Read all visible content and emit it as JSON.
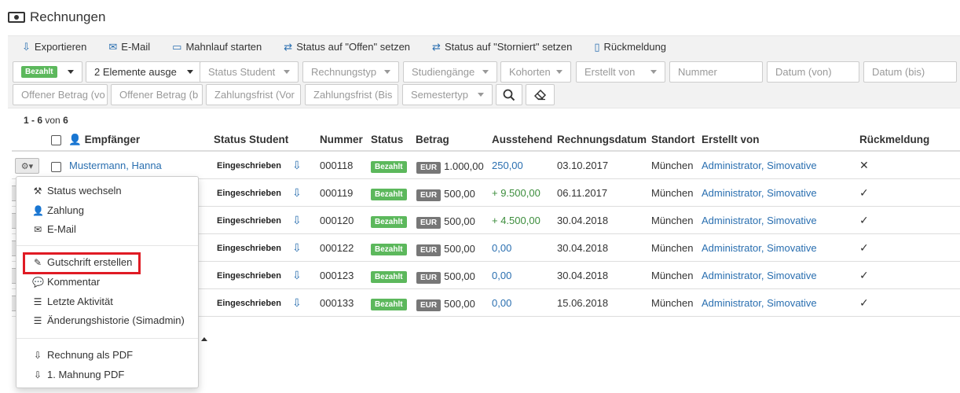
{
  "page": {
    "title": "Rechnungen",
    "title_icon": "money-bill-icon"
  },
  "toolbar": {
    "export": "Exportieren",
    "email": "E-Mail",
    "dunning": "Mahnlauf starten",
    "status_open": "Status auf \"Offen\" setzen",
    "status_cancelled": "Status auf \"Storniert\" setzen",
    "feedback": "Rückmeldung"
  },
  "filters": {
    "status_badge": "Bezahlt",
    "selected": "2 Elemente ausge",
    "status_student": "Status Student",
    "invoice_type": "Rechnungstyp",
    "programs": "Studiengänge",
    "cohorts": "Kohorten",
    "created_by": "Erstellt von",
    "number": "Nummer",
    "date_from": "Datum (von)",
    "date_to": "Datum (bis)",
    "open_amount_from": "Offener Betrag (vo",
    "open_amount_to": "Offener Betrag (b",
    "due_from": "Zahlungsfrist (Vor",
    "due_to": "Zahlungsfrist (Bis",
    "semester_type": "Semestertyp"
  },
  "count": {
    "range": "1 - 6",
    "of": "von",
    "total": "6"
  },
  "columns": {
    "recipient": "Empfänger",
    "status_student": "Status Student",
    "number": "Nummer",
    "status": "Status",
    "amount": "Betrag",
    "outstanding": "Ausstehend",
    "invoice_date": "Rechnungsdatum",
    "location": "Standort",
    "created_by": "Erstellt von",
    "feedback": "Rückmeldung"
  },
  "rows": [
    {
      "recipient": "Mustermann, Hanna",
      "status_student": "Eingeschrieben",
      "number": "000118",
      "status": "Bezahlt",
      "currency": "EUR",
      "amount": "1.000,00",
      "outstanding": "250,00",
      "date": "03.10.2017",
      "location": "München",
      "created_by": "Administrator, Simovative",
      "feedback": "✕"
    },
    {
      "recipient": "",
      "status_student": "Eingeschrieben",
      "number": "000119",
      "status": "Bezahlt",
      "currency": "EUR",
      "amount": "500,00",
      "outstanding": "+ 9.500,00",
      "date": "06.11.2017",
      "location": "München",
      "created_by": "Administrator, Simovative",
      "feedback": "✓"
    },
    {
      "recipient": "",
      "status_student": "Eingeschrieben",
      "number": "000120",
      "status": "Bezahlt",
      "currency": "EUR",
      "amount": "500,00",
      "outstanding": "+ 4.500,00",
      "date": "30.04.2018",
      "location": "München",
      "created_by": "Administrator, Simovative",
      "feedback": "✓"
    },
    {
      "recipient": "",
      "status_student": "Eingeschrieben",
      "number": "000122",
      "status": "Bezahlt",
      "currency": "EUR",
      "amount": "500,00",
      "outstanding": "0,00",
      "date": "30.04.2018",
      "location": "München",
      "created_by": "Administrator, Simovative",
      "feedback": "✓"
    },
    {
      "recipient": "",
      "status_student": "Eingeschrieben",
      "number": "000123",
      "status": "Bezahlt",
      "currency": "EUR",
      "amount": "500,00",
      "outstanding": "0,00",
      "date": "30.04.2018",
      "location": "München",
      "created_by": "Administrator, Simovative",
      "feedback": "✓"
    },
    {
      "recipient": "",
      "status_student": "Eingeschrieben",
      "number": "000133",
      "status": "Bezahlt",
      "currency": "EUR",
      "amount": "500,00",
      "outstanding": "0,00",
      "date": "15.06.2018",
      "location": "München",
      "created_by": "Administrator, Simovative",
      "feedback": "✓"
    }
  ],
  "menu": {
    "change_status": "Status wechseln",
    "payment": "Zahlung",
    "email": "E-Mail",
    "credit_note": "Gutschrift erstellen",
    "comment": "Kommentar",
    "last_activity": "Letzte Aktivität",
    "change_history": "Änderungshistorie (Simadmin)",
    "invoice_pdf": "Rechnung als PDF",
    "dunning_pdf": "1. Mahnung PDF"
  },
  "colors": {
    "accent": "#2a6fb0",
    "paid_green": "#5cb85c",
    "highlight_red": "#e01b24",
    "positive_green": "#3c8d3c"
  }
}
